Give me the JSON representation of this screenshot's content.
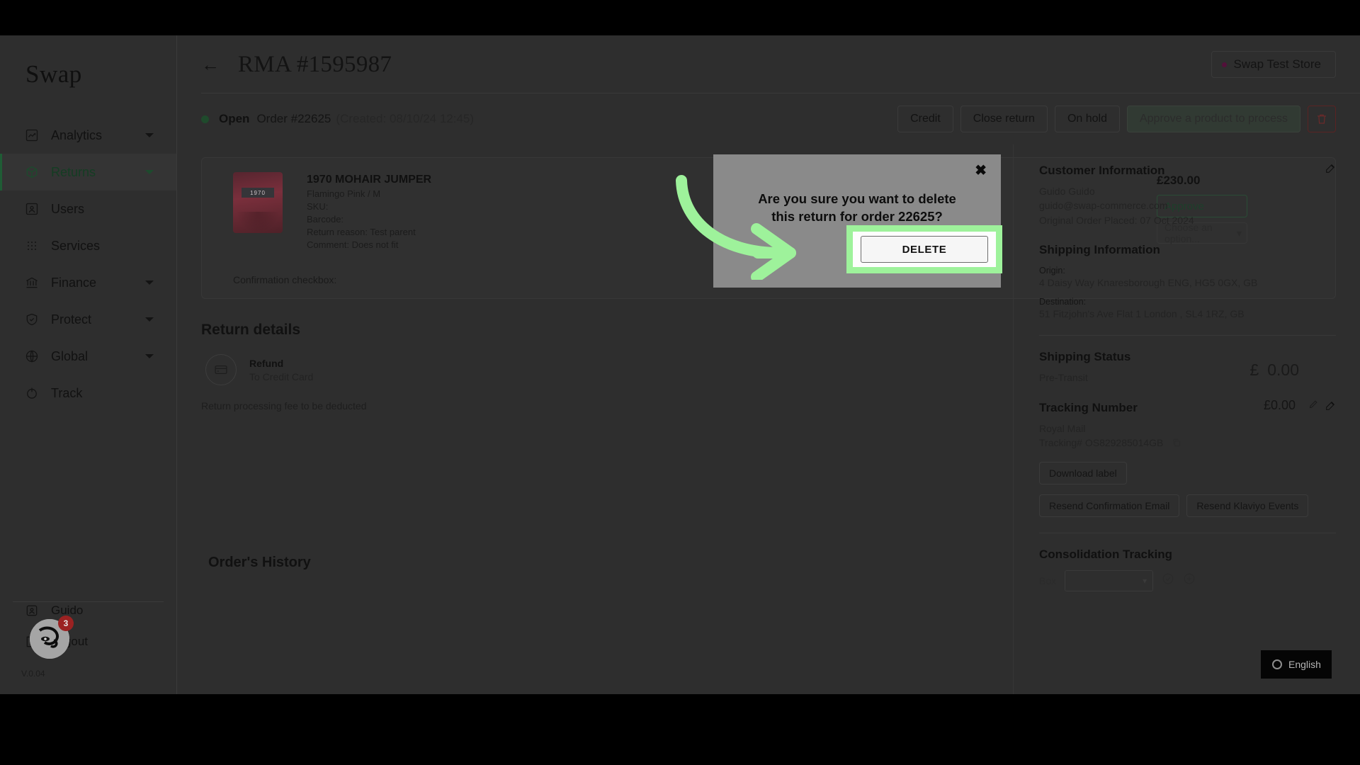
{
  "brand": "Swap",
  "sidebar": {
    "items": [
      {
        "label": "Analytics",
        "icon": "chart-icon",
        "caret": true,
        "active": false
      },
      {
        "label": "Returns",
        "icon": "box-icon",
        "caret": true,
        "active": true
      },
      {
        "label": "Users",
        "icon": "user-card-icon",
        "caret": false,
        "active": false
      },
      {
        "label": "Services",
        "icon": "grid-dots-icon",
        "caret": false,
        "active": false
      },
      {
        "label": "Finance",
        "icon": "bank-icon",
        "caret": true,
        "active": false
      },
      {
        "label": "Protect",
        "icon": "shield-check-icon",
        "caret": true,
        "active": false
      },
      {
        "label": "Global",
        "icon": "globe-icon",
        "caret": true,
        "active": false
      },
      {
        "label": "Track",
        "icon": "power-icon",
        "caret": false,
        "active": false
      }
    ],
    "account": {
      "label": "Guido",
      "icon": "account-icon"
    },
    "logout": {
      "label": "Logout",
      "icon": "logout-icon"
    },
    "version": "V.0.04",
    "chat_badge": "3"
  },
  "topbar": {
    "back_icon": "back-arrow-icon",
    "title": "RMA #1595987",
    "store": "Swap Test Store"
  },
  "status": {
    "state": "Open",
    "order": "Order #22625",
    "created": "(Created: 08/10/24 12:45)"
  },
  "actions": {
    "credit": "Credit",
    "close_return": "Close return",
    "on_hold": "On hold",
    "approve_disabled": "Approve a product to process",
    "delete_icon": "trash-icon"
  },
  "product": {
    "thumb_tag": "1970",
    "title": "1970 MOHAIR JUMPER",
    "variant": "Flamingo Pink / M",
    "sku": "SKU:",
    "barcode": "Barcode:",
    "return_reason": "Return reason: Test parent",
    "comment": "Comment: Does not fit",
    "price": "£230.00",
    "approve_label": "Approve",
    "option_placeholder": "Choose an option...",
    "confirmation_label": "Confirmation checkbox:"
  },
  "return_details": {
    "heading": "Return details",
    "refund_title": "Refund",
    "refund_method": "To Credit Card",
    "refund_currency": "£",
    "refund_amount": "0.00",
    "fee_label": "Return processing fee to be deducted",
    "fee_amount": "£0.00",
    "fee_edit_icon": "pencil-icon"
  },
  "history": {
    "heading": "Order's History"
  },
  "right_panel": {
    "customer": {
      "heading": "Customer Information",
      "edit_icon": "edit-icon",
      "name": "Guido Guido",
      "email": "guido@swap-commerce.com",
      "order_placed": "Original Order Placed: 07 Oct 2024"
    },
    "shipping": {
      "heading": "Shipping Information",
      "origin_label": "Origin:",
      "origin_value": "4 Daisy Way  Knaresborough ENG, HG5 0GX, GB",
      "destination_label": "Destination:",
      "destination_value": "51 Fitzjohn's Ave Flat 1 London , SL4 1RZ, GB"
    },
    "shipping_status": {
      "heading": "Shipping Status",
      "value": "Pre-Transit"
    },
    "tracking": {
      "heading": "Tracking Number",
      "edit_icon": "edit-icon",
      "carrier": "Royal Mail",
      "number": "Tracking# OS829285014GB",
      "copy_icon": "copy-icon"
    },
    "buttons": {
      "download_label": "Download label",
      "resend_email": "Resend Confirmation Email",
      "resend_klaviyo": "Resend Klaviyo Events"
    },
    "consolidation": {
      "heading": "Consolidation Tracking",
      "box_label": "Box",
      "select_value": "",
      "check_icon": "check-circle-icon",
      "add_icon": "plus-circle-icon"
    }
  },
  "modal": {
    "close_icon": "close-icon",
    "message": "Are you sure you want to delete this return for order 22625?",
    "delete_label": "DELETE"
  },
  "language_widget": {
    "icon": "circle-icon",
    "label": "English"
  },
  "colors": {
    "accent_green": "#9ef29b",
    "status_green": "#1f4a2c",
    "danger_red": "#5a2323",
    "badge_red": "#9b2222",
    "app_bg": "#2e2e2e",
    "modal_bg": "#8a8a8a"
  }
}
